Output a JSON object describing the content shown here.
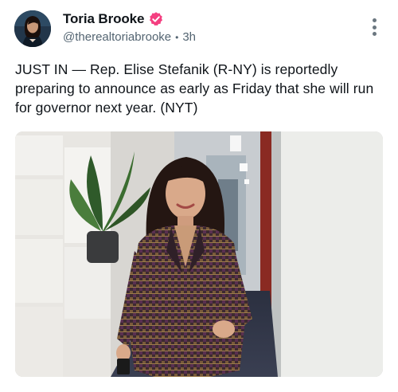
{
  "author": {
    "display_name": "Toria Brooke",
    "handle": "@therealtoriabrooke",
    "time_ago": "3h",
    "verified": true
  },
  "post": {
    "text": "JUST IN — Rep. Elise Stefanik (R-NY) is reportedly preparing to announce as early as Friday that she will run for governor next year. (NYT)"
  },
  "icons": {
    "verified": "verified-badge-icon",
    "more": "more-vertical-icon"
  },
  "colors": {
    "verified_badge": "#f43f80",
    "handle_gray": "#536471"
  }
}
